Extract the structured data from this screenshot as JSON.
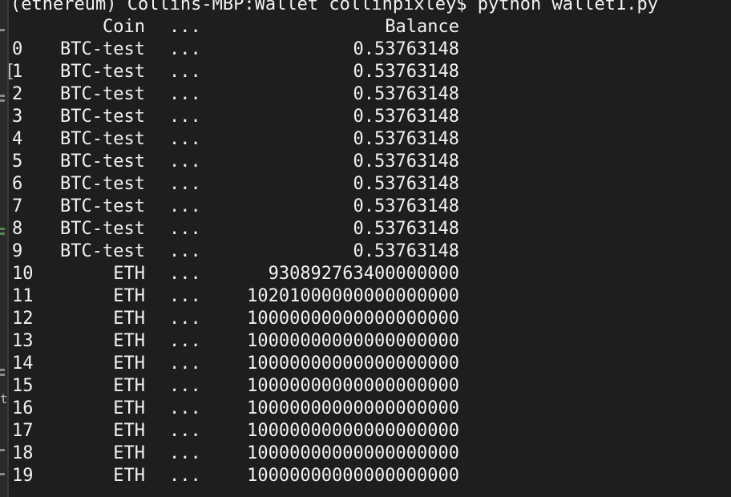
{
  "prompt": "(ethereum) Collins-MBP:Wallet collinpixley$ python wallet1.py",
  "header": {
    "coin": "Coin",
    "dots": "...",
    "balance": "Balance"
  },
  "rows": [
    {
      "index": "0",
      "coin": "BTC-test",
      "dots": "...",
      "balance": "0.53763148"
    },
    {
      "index": "1",
      "coin": "BTC-test",
      "dots": "...",
      "balance": "0.53763148"
    },
    {
      "index": "2",
      "coin": "BTC-test",
      "dots": "...",
      "balance": "0.53763148"
    },
    {
      "index": "3",
      "coin": "BTC-test",
      "dots": "...",
      "balance": "0.53763148"
    },
    {
      "index": "4",
      "coin": "BTC-test",
      "dots": "...",
      "balance": "0.53763148"
    },
    {
      "index": "5",
      "coin": "BTC-test",
      "dots": "...",
      "balance": "0.53763148"
    },
    {
      "index": "6",
      "coin": "BTC-test",
      "dots": "...",
      "balance": "0.53763148"
    },
    {
      "index": "7",
      "coin": "BTC-test",
      "dots": "...",
      "balance": "0.53763148"
    },
    {
      "index": "8",
      "coin": "BTC-test",
      "dots": "...",
      "balance": "0.53763148"
    },
    {
      "index": "9",
      "coin": "BTC-test",
      "dots": "...",
      "balance": "0.53763148"
    },
    {
      "index": "10",
      "coin": "ETH",
      "dots": "...",
      "balance": "930892763400000000"
    },
    {
      "index": "11",
      "coin": "ETH",
      "dots": "...",
      "balance": "10201000000000000000"
    },
    {
      "index": "12",
      "coin": "ETH",
      "dots": "...",
      "balance": "10000000000000000000"
    },
    {
      "index": "13",
      "coin": "ETH",
      "dots": "...",
      "balance": "10000000000000000000"
    },
    {
      "index": "14",
      "coin": "ETH",
      "dots": "...",
      "balance": "10000000000000000000"
    },
    {
      "index": "15",
      "coin": "ETH",
      "dots": "...",
      "balance": "10000000000000000000"
    },
    {
      "index": "16",
      "coin": "ETH",
      "dots": "...",
      "balance": "10000000000000000000"
    },
    {
      "index": "17",
      "coin": "ETH",
      "dots": "...",
      "balance": "10000000000000000000"
    },
    {
      "index": "18",
      "coin": "ETH",
      "dots": "...",
      "balance": "10000000000000000000"
    },
    {
      "index": "19",
      "coin": "ETH",
      "dots": "...",
      "balance": "10000000000000000000"
    }
  ],
  "gutter": {
    "bracket": "[",
    "letter": "t"
  },
  "colors": {
    "background": "#1e1e1e",
    "text": "#f2f2f2",
    "gutter_mark": "#8a8a8a",
    "gutter_mark_green": "#4f8a4f"
  }
}
